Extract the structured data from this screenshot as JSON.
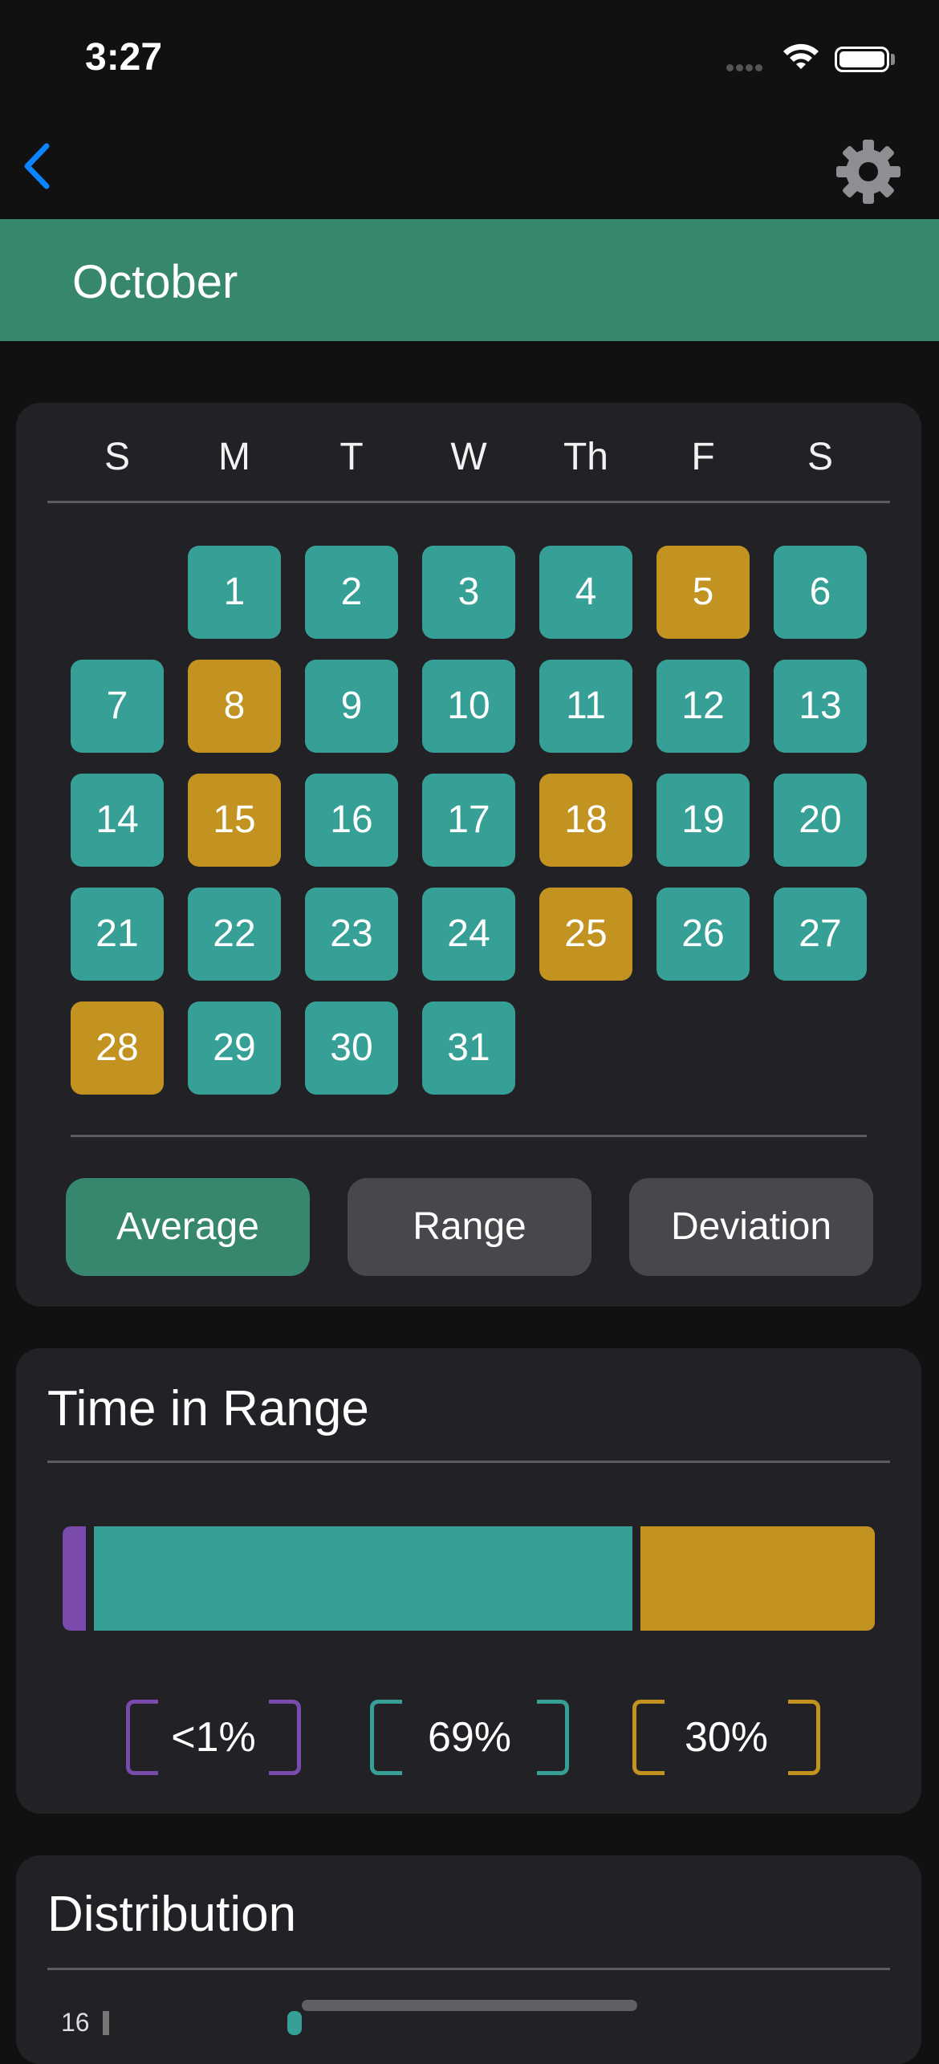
{
  "status_bar": {
    "time": "3:27"
  },
  "header": {
    "month": "October"
  },
  "calendar": {
    "weekdays": [
      "S",
      "M",
      "T",
      "W",
      "Th",
      "F",
      "S"
    ],
    "first_weekday_index": 1,
    "days": [
      "1",
      "2",
      "3",
      "4",
      "5",
      "6",
      "7",
      "8",
      "9",
      "10",
      "11",
      "12",
      "13",
      "14",
      "15",
      "16",
      "17",
      "18",
      "19",
      "20",
      "21",
      "22",
      "23",
      "24",
      "25",
      "26",
      "27",
      "28",
      "29",
      "30",
      "31"
    ],
    "gold_days": [
      "5",
      "8",
      "15",
      "18",
      "25",
      "28"
    ],
    "colors": {
      "in_range": "#36a096",
      "high": "#c39321"
    }
  },
  "modes": {
    "average": "Average",
    "range": "Range",
    "deviation": "Deviation",
    "active": "Average"
  },
  "time_in_range": {
    "title": "Time in Range",
    "segments": [
      {
        "label": "<1%",
        "fraction": 0.01,
        "color": "#7a4bad"
      },
      {
        "label": "69%",
        "fraction": 0.69,
        "color": "#36a096"
      },
      {
        "label": "30%",
        "fraction": 0.3,
        "color": "#c39321"
      }
    ]
  },
  "distribution": {
    "title": "Distribution",
    "first_tick": "16"
  },
  "icons": {
    "back": "chevron-left-icon",
    "settings": "gear-icon",
    "accent": "#0a84ff"
  }
}
